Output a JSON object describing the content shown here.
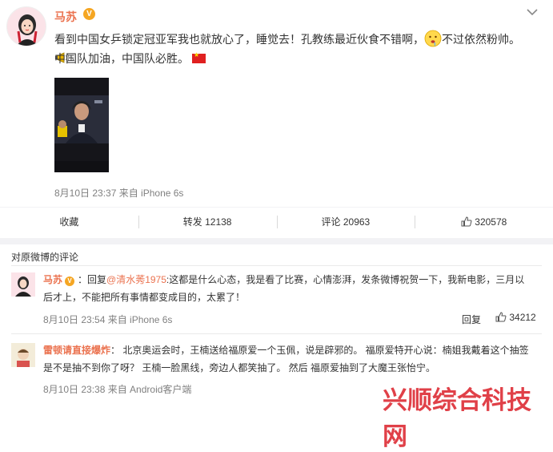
{
  "post": {
    "author": "马苏",
    "verified_badge": "V",
    "text_part1": "看到中国女乒锁定冠亚军我也就放心了，睡觉去！孔教练最近伙食不错啊，",
    "text_part2": "不过依然粉帅。",
    "text_line2": "中国队加油，中国队必胜。",
    "time_source": "8月10日 23:37 来自 iPhone 6s",
    "actions": {
      "favorite": "收藏",
      "repost": "转发 12138",
      "comment": "评论 20963",
      "like": "320578"
    }
  },
  "comments_title": "对原微博的评论",
  "comments": [
    {
      "author": "马苏",
      "badge": "V",
      "reply_prefix": "：回复",
      "mention": "@清水莠1975",
      "text": ":这都是什么心态，我是看了比赛，心情澎湃，发条微博祝贺一下，我新电影，三月以后才上，不能把所有事情都变成目的，太累了！",
      "time_source": "8月10日 23:54 来自 iPhone 6s",
      "reply_label": "回复",
      "likes": "34212"
    },
    {
      "author": "雷顿请直接爆炸",
      "text": "： 北京奥运会时，王楠送给福原爱一个玉佩，说是辟邪的。 福原爱特开心说：楠姐我戴着这个抽签是不是抽不到你了呀？ 王楠一脸黑线，旁边人都笑抽了。 然后 福原爱抽到了大魔王张怡宁。",
      "time_source": "8月10日 23:38 来自 Android客户端"
    }
  ],
  "watermark": "兴顺综合科技网",
  "icons": {
    "chevron": "chevron-down-icon",
    "like": "thumbs-up-icon",
    "megaphone": "megaphone-icon",
    "emoji": "drooling-emoji-icon",
    "flag": "china-flag-icon"
  },
  "colors": {
    "accent": "#eb7350",
    "badge": "#f5a623",
    "watermark": "#e04048"
  }
}
